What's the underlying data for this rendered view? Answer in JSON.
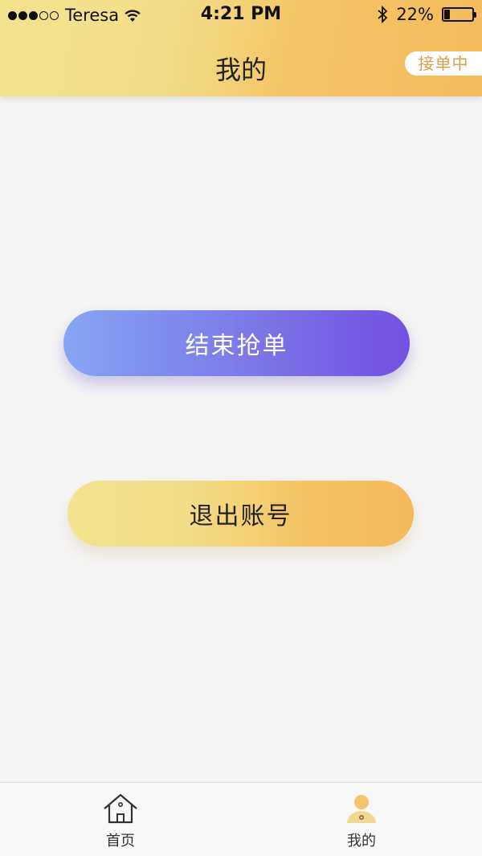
{
  "status_bar": {
    "carrier": "Teresa",
    "time": "4:21 PM",
    "battery": "22%",
    "battery_level": 0.22
  },
  "header": {
    "title": "我的",
    "status_tag": "接单中"
  },
  "actions": {
    "end_grab_label": "结束抢单",
    "logout_label": "退出账号"
  },
  "tabbar": {
    "items": [
      {
        "label": "首页",
        "icon": "home-icon"
      },
      {
        "label": "我的",
        "icon": "user-icon"
      }
    ]
  },
  "colors": {
    "header_gradient_start": "#f2e38f",
    "header_gradient_end": "#f4bb5c",
    "primary_gradient_start": "#86a6f4",
    "primary_gradient_end": "#7350e2",
    "accent": "#f4bb5c"
  }
}
